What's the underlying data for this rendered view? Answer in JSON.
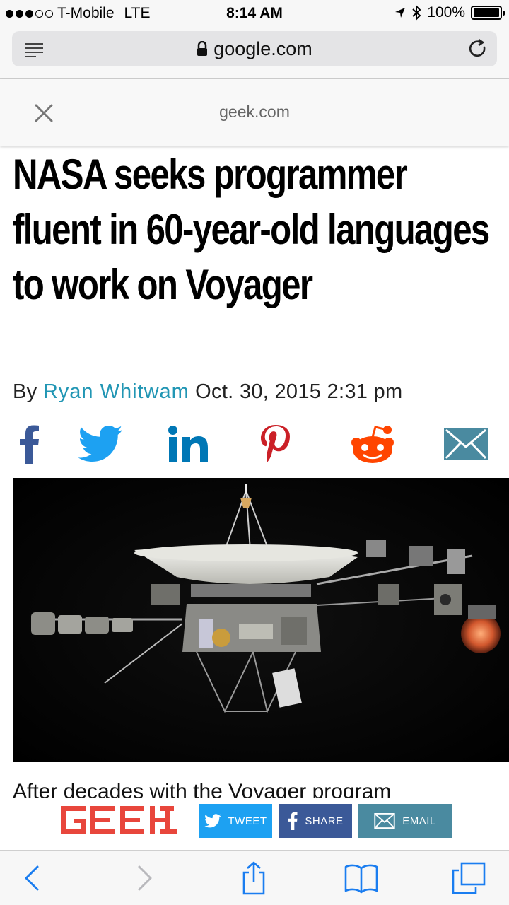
{
  "status_bar": {
    "carrier": "T-Mobile",
    "network": "LTE",
    "time": "8:14 AM",
    "battery": "100%",
    "battery_level": 1.0,
    "signal_bars": 3,
    "signal_total": 5
  },
  "browser": {
    "url": "google.com",
    "icons": [
      "menu-icon",
      "lock-icon",
      "reload-icon"
    ]
  },
  "amp_header": {
    "source": "geek.com",
    "close_icon": "close-icon"
  },
  "article": {
    "headline": "NASA seeks programmer fluent in 60-year-old languages to work on Voyager",
    "byline_prefix": "By",
    "author": "Ryan Whitwam",
    "date": "Oct. 30, 2015 2:31 pm",
    "body_start": "After decades with the Voyager program"
  },
  "share_icons": [
    {
      "name": "facebook",
      "color": "#3b5998"
    },
    {
      "name": "twitter",
      "color": "#1da1f2"
    },
    {
      "name": "linkedin",
      "color": "#0077b5"
    },
    {
      "name": "pinterest",
      "color": "#cb2027"
    },
    {
      "name": "reddit",
      "color": "#ff4500"
    },
    {
      "name": "email",
      "color": "#4a8aa0"
    }
  ],
  "sticky_bar": {
    "logo": "GEEK",
    "tweet_label": "TWEET",
    "share_label": "SHARE",
    "email_label": "EMAIL",
    "colors": {
      "tweet": "#1da1f2",
      "share": "#3b5998",
      "email": "#4a8aa0",
      "logo": "#e8463c"
    }
  },
  "toolbar": {
    "icons": [
      "back-icon",
      "forward-icon",
      "share-icon",
      "bookmarks-icon",
      "tabs-icon"
    ]
  }
}
